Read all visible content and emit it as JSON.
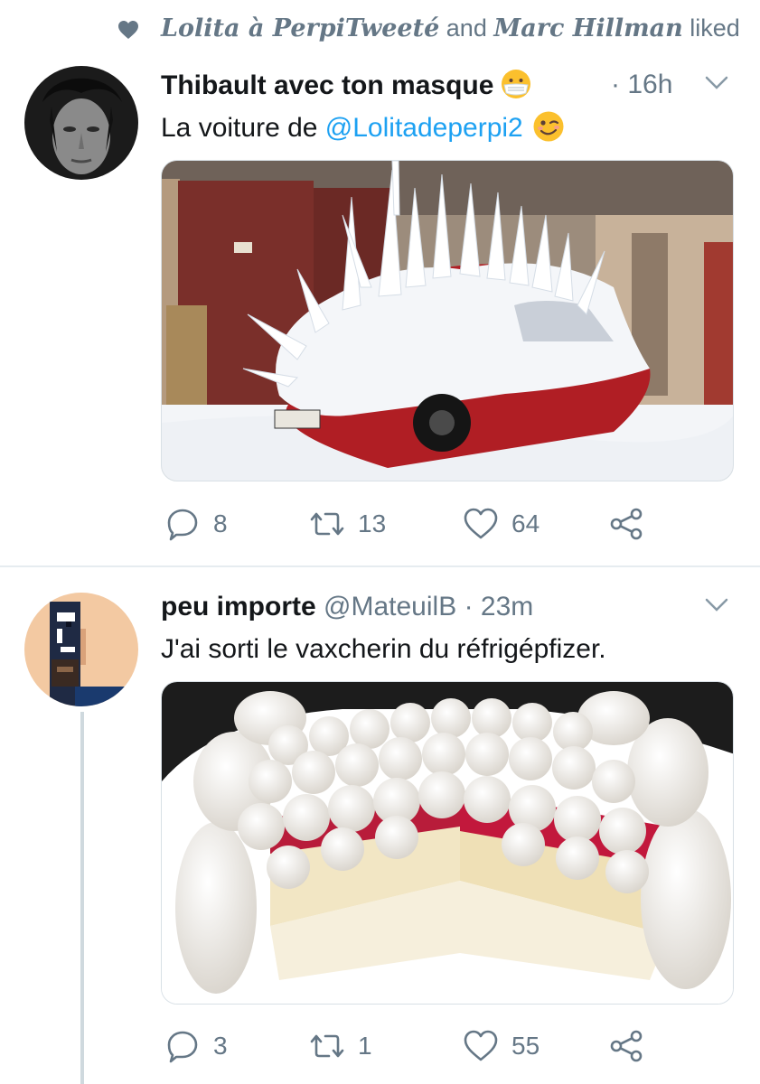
{
  "social_context": {
    "user1": "Lolita à PerpiTweeté",
    "conjunction": "and",
    "user2": "Marc Hillman",
    "action": "liked",
    "icon": "heart-icon"
  },
  "tweets": [
    {
      "display_name": "Thibault avec ton masque",
      "name_emoji": "face-with-medical-mask-emoji",
      "time": "16h",
      "text_before": "La voiture de ",
      "mention": "@Lolitadeperpi2",
      "text_emoji": "winking-face-emoji",
      "media": "snow-covered-red-car-with-icicles-photo",
      "counts": {
        "replies": "8",
        "retweets": "13",
        "likes": "64"
      }
    },
    {
      "display_name": "peu importe",
      "handle": "@MateuilB",
      "time": "23m",
      "text": "J'ai sorti le vaxcherin du réfrigépfizer.",
      "media": "vacherin-meringue-cake-photo",
      "counts": {
        "replies": "3",
        "retweets": "1",
        "likes": "55"
      }
    }
  ],
  "colors": {
    "accent": "#1da1f2",
    "secondary_text": "#657786",
    "primary_text": "#14171a",
    "divider": "#e6ecf0"
  }
}
